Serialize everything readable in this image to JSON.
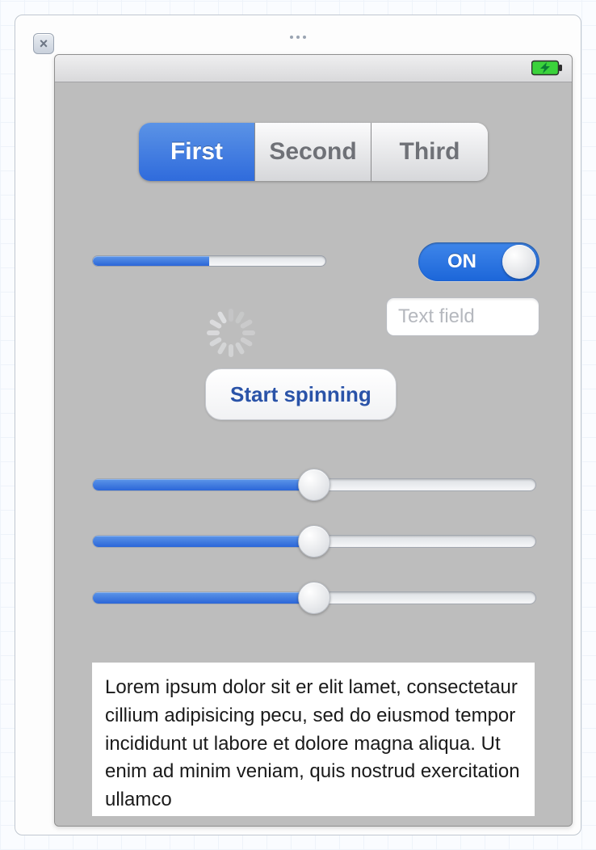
{
  "segmented": {
    "items": [
      "First",
      "Second",
      "Third"
    ],
    "selected_index": 0
  },
  "progress": {
    "percent": 50
  },
  "switch": {
    "on_label": "ON",
    "state": true
  },
  "textfield": {
    "placeholder": "Text field",
    "value": ""
  },
  "spin_button": {
    "label": "Start spinning"
  },
  "sliders": [
    {
      "percent": 50
    },
    {
      "percent": 50
    },
    {
      "percent": 50
    }
  ],
  "textview": {
    "content": "Lorem ipsum dolor sit er elit lamet, consectetaur cillium adipisicing pecu, sed do eiusmod tempor incididunt ut labore et dolore magna aliqua. Ut enim ad minim veniam, quis nostrud exercitation ullamco"
  },
  "status_bar": {
    "battery_icon": "battery-charging"
  },
  "colors": {
    "accent": "#2f6bdc",
    "accent_light": "#5b93e6",
    "canvas": "#bdbdbd"
  }
}
